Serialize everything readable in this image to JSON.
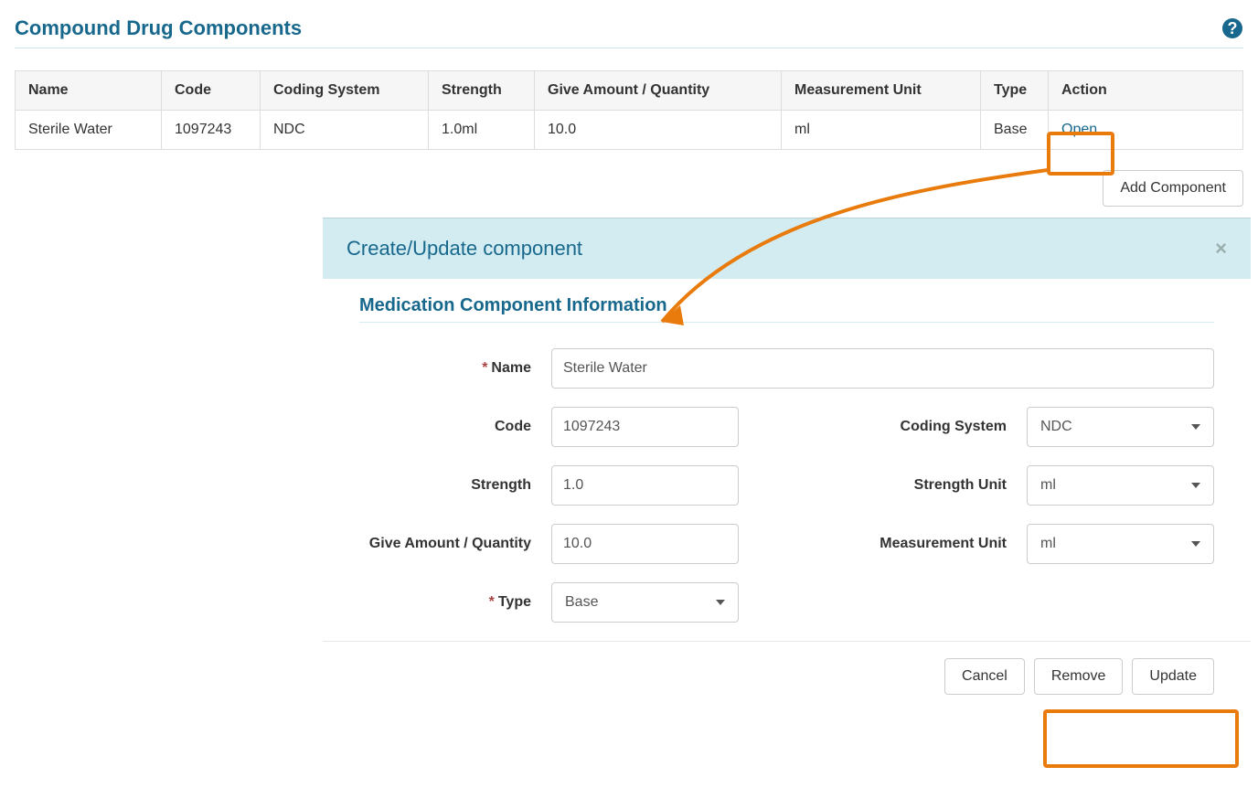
{
  "section": {
    "title": "Compound Drug Components"
  },
  "table": {
    "headers": {
      "name": "Name",
      "code": "Code",
      "coding_system": "Coding System",
      "strength": "Strength",
      "give_amount": "Give Amount / Quantity",
      "measurement_unit": "Measurement Unit",
      "type": "Type",
      "action": "Action"
    },
    "rows": [
      {
        "name": "Sterile Water",
        "code": "1097243",
        "coding_system": "NDC",
        "strength": "1.0ml",
        "give_amount": "10.0",
        "measurement_unit": "ml",
        "type": "Base",
        "action": "Open"
      }
    ]
  },
  "buttons": {
    "add_component": "Add Component",
    "cancel": "Cancel",
    "remove": "Remove",
    "update": "Update"
  },
  "panel": {
    "title": "Create/Update component",
    "subtitle": "Medication Component Information",
    "close": "×"
  },
  "form": {
    "labels": {
      "name": "Name",
      "code": "Code",
      "coding_system": "Coding System",
      "strength": "Strength",
      "strength_unit": "Strength Unit",
      "give_amount": "Give Amount / Quantity",
      "measurement_unit": "Measurement Unit",
      "type": "Type",
      "required": "*"
    },
    "values": {
      "name": "Sterile Water",
      "code": "1097243",
      "coding_system": "NDC",
      "strength": "1.0",
      "strength_unit": "ml",
      "give_amount": "10.0",
      "measurement_unit": "ml",
      "type": "Base"
    }
  }
}
